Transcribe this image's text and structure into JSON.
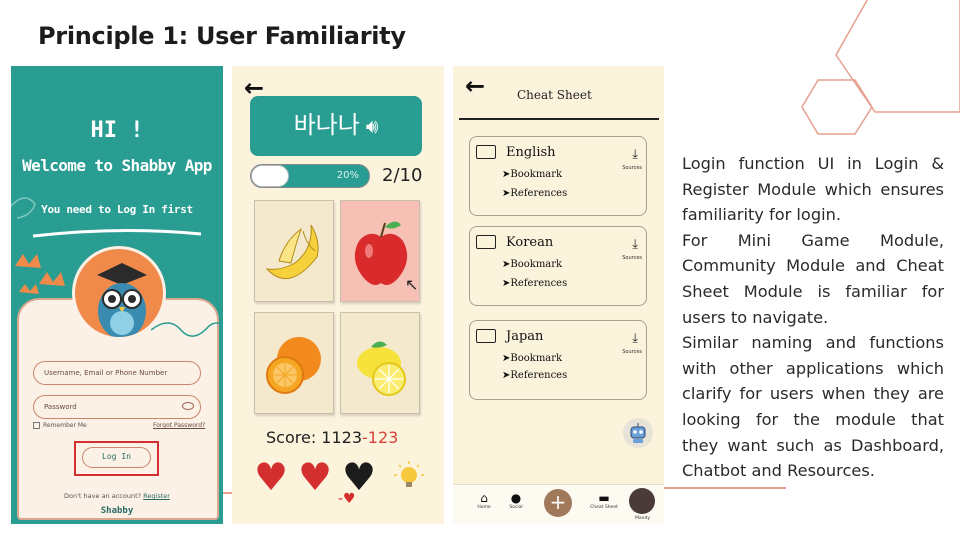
{
  "slide": {
    "title": "Principle 1: User Familiarity",
    "description": [
      "Login function UI in Login & Register Module which ensures familiarity for login.",
      "For Mini Game Module, Community Module and Cheat Sheet Module is familiar for users to navigate.",
      "Similar naming and functions with other applications which clarify for users when they are looking for the module that they want such as Dashboard, Chatbot and Resources."
    ],
    "accent_color": "#e6a08d"
  },
  "login_screen": {
    "greeting": "HI !",
    "welcome": "Welcome to Shabby App",
    "instruction": "You need to Log In first",
    "username_placeholder": "Username, Email or Phone Number",
    "password_placeholder": "Password",
    "remember_label": "Remember Me",
    "forgot_label": "Forgot Password?",
    "login_button": "Log In",
    "no_account": "Don't have an account?",
    "register_link": "Register",
    "brand": "Shabby",
    "theme_color": "#2a9d92",
    "highlight_color": "#d42f2f"
  },
  "game_screen": {
    "back_icon": "arrow-left-icon",
    "word": "바나나",
    "speaker_icon": "speaker-icon",
    "progress_percent": 20,
    "progress_label": "20%",
    "question_counter": "2/10",
    "tiles": [
      {
        "name": "banana",
        "selected": false
      },
      {
        "name": "apple",
        "selected": true
      },
      {
        "name": "orange",
        "selected": false
      },
      {
        "name": "lemon",
        "selected": false
      }
    ],
    "score_label": "Score: 1123",
    "score_penalty": "-123",
    "lives": [
      {
        "state": "full",
        "color": "#d42f2f"
      },
      {
        "state": "full",
        "color": "#d42f2f"
      },
      {
        "state": "lost",
        "color": "#1c1c1c"
      }
    ],
    "hint_icon": "lightbulb-icon"
  },
  "cheat_sheet_screen": {
    "back_icon": "arrow-left-icon",
    "title": "Cheat Sheet",
    "folders": [
      {
        "name": "English",
        "items": [
          "➤Bookmark",
          "➤References"
        ],
        "source_label": "Sources"
      },
      {
        "name": "Korean",
        "items": [
          "➤Bookmark",
          "➤References"
        ],
        "source_label": "Sources"
      },
      {
        "name": "Japan",
        "items": [
          "➤Bookmark",
          "➤References"
        ],
        "source_label": "Sources"
      }
    ],
    "nav": {
      "home": "Home",
      "social": "Social",
      "cheat_sheet": "Cheat Sheet",
      "profile": "Mandy"
    }
  }
}
